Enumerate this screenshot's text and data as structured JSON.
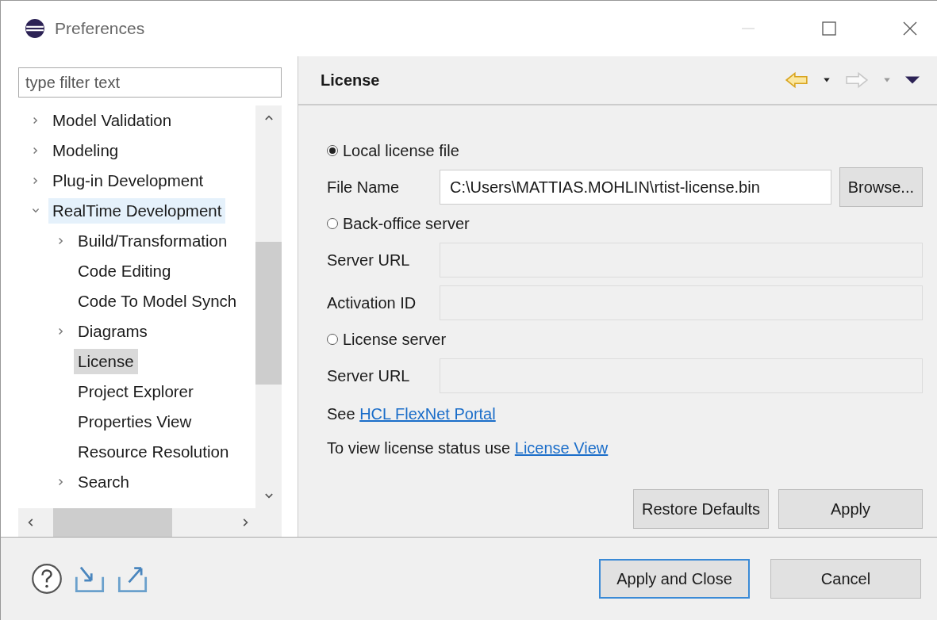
{
  "window": {
    "title": "Preferences"
  },
  "filter": {
    "placeholder": "type filter text"
  },
  "tree": [
    {
      "label": "Model Validation",
      "expandable": true,
      "expanded": false,
      "selected": false,
      "hovered": false
    },
    {
      "label": "Modeling",
      "expandable": true,
      "expanded": false,
      "selected": false,
      "hovered": false
    },
    {
      "label": "Plug-in Development",
      "expandable": true,
      "expanded": false,
      "selected": false,
      "hovered": false
    },
    {
      "label": "RealTime Development",
      "expandable": true,
      "expanded": true,
      "selected": false,
      "hovered": true,
      "children": [
        {
          "label": "Build/Transformation",
          "expandable": true,
          "selected": false,
          "hovered": false
        },
        {
          "label": "Code Editing",
          "expandable": false,
          "selected": false,
          "hovered": false
        },
        {
          "label": "Code To Model Synch",
          "expandable": false,
          "selected": false,
          "hovered": false
        },
        {
          "label": "Diagrams",
          "expandable": true,
          "selected": false,
          "hovered": false
        },
        {
          "label": "License",
          "expandable": false,
          "selected": true,
          "hovered": false
        },
        {
          "label": "Project Explorer",
          "expandable": false,
          "selected": false,
          "hovered": false
        },
        {
          "label": "Properties View",
          "expandable": false,
          "selected": false,
          "hovered": false
        },
        {
          "label": "Resource Resolution",
          "expandable": false,
          "selected": false,
          "hovered": false
        },
        {
          "label": "Search",
          "expandable": true,
          "selected": false,
          "hovered": false
        }
      ]
    }
  ],
  "page": {
    "title": "License"
  },
  "license_options": [
    {
      "label": "Local license file",
      "selected": true,
      "fields": [
        {
          "label": "File Name",
          "value": "C:\\Users\\MATTIAS.MOHLIN\\rtist-license.bin",
          "disabled": false,
          "button": "Browse..."
        }
      ]
    },
    {
      "label": "Back-office server",
      "selected": false,
      "fields": [
        {
          "label": "Server URL",
          "disabled": true
        },
        {
          "label": "Activation ID",
          "disabled": true
        }
      ]
    },
    {
      "label": "License server",
      "selected": false,
      "fields": [
        {
          "label": "Server URL",
          "disabled": true
        }
      ]
    }
  ],
  "info_lines": [
    {
      "text": "See",
      "link": "HCL FlexNet Portal"
    },
    {
      "text": "To view license status use",
      "link": "License View"
    }
  ],
  "page_buttons": [
    "Restore Defaults",
    "Apply"
  ],
  "dialog_buttons": [
    {
      "label": "Apply and Close",
      "default": true
    },
    {
      "label": "Cancel",
      "default": false
    }
  ]
}
